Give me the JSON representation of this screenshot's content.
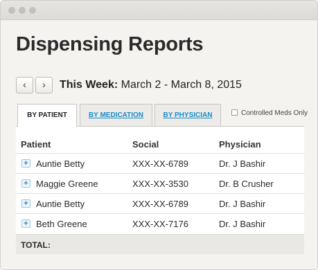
{
  "page": {
    "title": "Dispensing Reports"
  },
  "week": {
    "label": "This Week:",
    "range": "March 2 - March 8, 2015",
    "prev": "‹",
    "next": "›"
  },
  "tabs": [
    {
      "label": "BY PATIENT",
      "active": true
    },
    {
      "label": "BY MEDICATION",
      "active": false
    },
    {
      "label": "BY PHYSICIAN",
      "active": false
    }
  ],
  "filter": {
    "controlled_label": "Controlled Meds Only",
    "checked": false
  },
  "table": {
    "columns": [
      "Patient",
      "Social",
      "Physician"
    ],
    "rows": [
      {
        "expand": "+",
        "patient": "Auntie Betty",
        "social": "XXX-XX-6789",
        "physician": "Dr. J Bashir"
      },
      {
        "expand": "+",
        "patient": "Maggie Greene",
        "social": "XXX-XX-3530",
        "physician": "Dr. B Crusher"
      },
      {
        "expand": "+",
        "patient": "Auntie Betty",
        "social": "XXX-XX-6789",
        "physician": "Dr. J Bashir"
      },
      {
        "expand": "+",
        "patient": "Beth Greene",
        "social": "XXX-XX-7176",
        "physician": "Dr. J Bashir"
      }
    ],
    "total_label": "TOTAL:"
  }
}
